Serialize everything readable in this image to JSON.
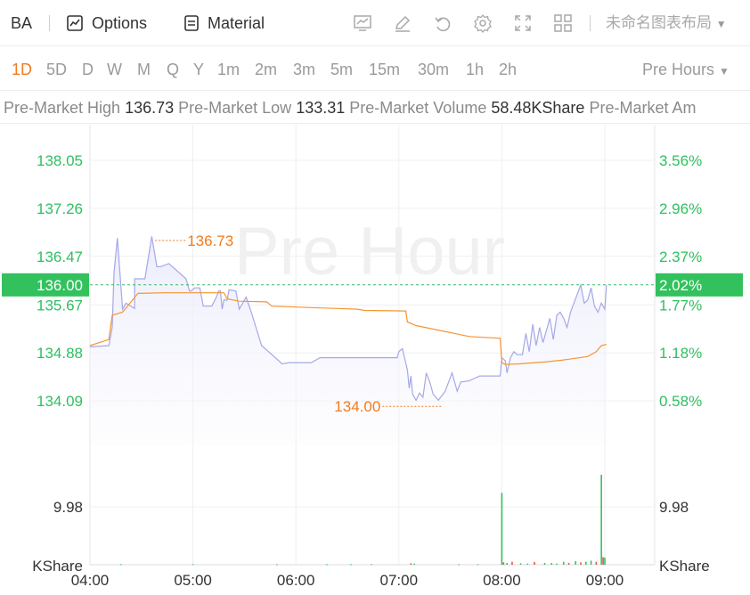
{
  "toolbar": {
    "symbol": "BA",
    "options_label": "Options",
    "material_label": "Material",
    "layout_label": "未命名图表布局"
  },
  "intervals": {
    "items": [
      "1D",
      "5D",
      "D",
      "W",
      "M",
      "Q",
      "Y",
      "1m",
      "2m",
      "3m",
      "5m",
      "15m",
      "30m",
      "1h",
      "2h"
    ],
    "active": "1D",
    "session_label": "Pre Hours"
  },
  "stats": {
    "high_label": "Pre-Market High",
    "high_value": "136.73",
    "low_label": "Pre-Market Low",
    "low_value": "133.31",
    "volume_label": "Pre-Market Volume",
    "volume_value": "58.48KShare",
    "amount_label": "Pre-Market Am"
  },
  "colors": {
    "price_line": "#a6a8e6",
    "avg_line": "#f5952f",
    "axis_text": "#2fbf60",
    "current_badge": "#33c15e",
    "volume_bar": "#33c15e",
    "volume_bar_down": "#e0524a",
    "annotation": "#f07c1f"
  },
  "chart_data": {
    "type": "line",
    "watermark": "Pre Hour",
    "price_axis": {
      "ticks": [
        "138.05",
        "137.26",
        "136.47",
        "135.67",
        "134.88",
        "134.09"
      ],
      "tick_values": [
        138.05,
        137.26,
        136.47,
        135.67,
        134.88,
        134.09
      ],
      "pct_ticks": [
        "3.56%",
        "2.96%",
        "2.37%",
        "1.77%",
        "1.18%",
        "0.58%"
      ],
      "current_price": "136.00",
      "current_pct": "2.02%",
      "current_value": 136.0
    },
    "x_axis": {
      "labels": [
        "04:00",
        "05:00",
        "06:00",
        "07:00",
        "08:00",
        "09:00"
      ],
      "start_min": 240,
      "end_min": 545
    },
    "annotations": [
      {
        "label": "136.73",
        "t": 278,
        "value": 136.73
      },
      {
        "label": "134.00",
        "t": 427,
        "value": 134.0
      }
    ],
    "series": [
      {
        "key": "price",
        "t": [
          240,
          251,
          253,
          254,
          256,
          259,
          261,
          266,
          266,
          272,
          276,
          279,
          281,
          286,
          296,
          298,
          299,
          301,
          304,
          306,
          311,
          314,
          315,
          316,
          317,
          318,
          320,
          321,
          325,
          327,
          329,
          331,
          334,
          340,
          348,
          352,
          356,
          358,
          361,
          365,
          369,
          374,
          383,
          393,
          398,
          403,
          413,
          419,
          420,
          422,
          425,
          426,
          427,
          428,
          430,
          432,
          434,
          436,
          438,
          440,
          443,
          447,
          451,
          454,
          456,
          461,
          467,
          475,
          479,
          480,
          482,
          483,
          485,
          487,
          489,
          492,
          494,
          496,
          498,
          500,
          502,
          504,
          506,
          508,
          510,
          512,
          514,
          516,
          518,
          520,
          522,
          524,
          526,
          528,
          530,
          532,
          534,
          536,
          538,
          540,
          541
        ],
        "values": [
          134.98,
          135.0,
          135.3,
          136.2,
          136.77,
          135.6,
          135.7,
          135.61,
          136.1,
          136.1,
          136.8,
          136.3,
          136.3,
          136.35,
          136.1,
          135.9,
          135.9,
          135.95,
          135.95,
          135.65,
          135.65,
          135.82,
          135.9,
          135.9,
          135.6,
          135.75,
          135.75,
          135.92,
          135.9,
          135.6,
          135.7,
          135.8,
          135.55,
          135.0,
          134.8,
          134.7,
          134.72,
          134.72,
          134.72,
          134.72,
          134.72,
          134.8,
          134.8,
          134.8,
          134.8,
          134.8,
          134.8,
          134.8,
          134.9,
          134.95,
          134.6,
          134.3,
          134.5,
          134.2,
          134.1,
          134.22,
          134.15,
          134.55,
          134.4,
          134.2,
          134.1,
          134.25,
          134.55,
          134.25,
          134.4,
          134.42,
          134.5,
          134.5,
          134.5,
          134.8,
          134.75,
          134.55,
          134.8,
          134.9,
          134.85,
          134.85,
          135.2,
          134.9,
          135.35,
          135.0,
          135.3,
          135.05,
          135.25,
          135.45,
          135.1,
          135.5,
          135.55,
          135.45,
          135.3,
          135.55,
          135.7,
          135.85,
          136.0,
          135.7,
          135.75,
          135.95,
          135.65,
          135.55,
          135.7,
          135.6,
          136.0
        ]
      },
      {
        "key": "average",
        "t": [
          240,
          251,
          253,
          259,
          268,
          284,
          290,
          318,
          320,
          327,
          343,
          346,
          374,
          396,
          400,
          424,
          425,
          430,
          461,
          479,
          480,
          482,
          490,
          505,
          515,
          530,
          535,
          538,
          541
        ],
        "values": [
          135.0,
          135.1,
          135.5,
          135.55,
          135.86,
          135.87,
          135.87,
          135.87,
          135.77,
          135.73,
          135.72,
          135.65,
          135.62,
          135.6,
          135.58,
          135.57,
          135.39,
          135.33,
          135.15,
          135.12,
          134.72,
          134.69,
          134.7,
          134.73,
          134.76,
          134.82,
          134.9,
          135.0,
          135.02
        ]
      }
    ],
    "volume": {
      "axis_label": "KShare",
      "tick": "9.98",
      "tick_value": 9.98,
      "max_value": 15,
      "bars": [
        {
          "t": 258,
          "v": 0.1
        },
        {
          "t": 300,
          "v": 0.1
        },
        {
          "t": 349,
          "v": 0.1
        },
        {
          "t": 378,
          "v": 0.1
        },
        {
          "t": 392,
          "v": 0.1
        },
        {
          "t": 404,
          "v": 0.1
        },
        {
          "t": 427,
          "v": 0.25,
          "down": true
        },
        {
          "t": 429,
          "v": 0.2
        },
        {
          "t": 455,
          "v": 0.1
        },
        {
          "t": 466,
          "v": 0.1
        },
        {
          "t": 480,
          "v": 12.4
        },
        {
          "t": 481,
          "v": 0.4,
          "down": true
        },
        {
          "t": 483,
          "v": 0.3
        },
        {
          "t": 486,
          "v": 0.5,
          "down": true
        },
        {
          "t": 491,
          "v": 0.25
        },
        {
          "t": 495,
          "v": 0.2
        },
        {
          "t": 499,
          "v": 0.45,
          "down": true
        },
        {
          "t": 505,
          "v": 0.3
        },
        {
          "t": 509,
          "v": 0.3
        },
        {
          "t": 512,
          "v": 0.2
        },
        {
          "t": 516,
          "v": 0.5
        },
        {
          "t": 519,
          "v": 0.3,
          "down": true
        },
        {
          "t": 523,
          "v": 0.6
        },
        {
          "t": 526,
          "v": 0.4,
          "down": true
        },
        {
          "t": 529,
          "v": 0.5
        },
        {
          "t": 532,
          "v": 0.7
        },
        {
          "t": 535,
          "v": 0.5,
          "down": true
        },
        {
          "t": 538,
          "v": 15.5
        },
        {
          "t": 539,
          "v": 1.3,
          "down": true
        },
        {
          "t": 540,
          "v": 1.2
        }
      ]
    }
  }
}
